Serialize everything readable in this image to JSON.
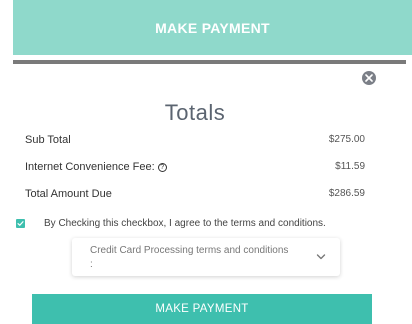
{
  "top_banner": {
    "label": "MAKE PAYMENT"
  },
  "modal": {
    "title": "Totals",
    "rows": [
      {
        "label": "Sub Total",
        "value": "$275.00"
      },
      {
        "label": "Internet Convenience Fee:",
        "value": "$11.59",
        "has_help_icon": true
      },
      {
        "label": "Total Amount Due",
        "value": "$286.59"
      }
    ],
    "agreement": {
      "checked": true,
      "text": "By Checking this checkbox, I agree to the terms and conditions."
    },
    "terms_dropdown": {
      "label": "Credit Card Processing terms and conditions :"
    },
    "pay_button": {
      "label": "MAKE PAYMENT"
    }
  },
  "colors": {
    "banner": "#8fd9cb",
    "accent": "#3ebfae",
    "title": "#5b6470"
  },
  "icons": {
    "close": "close-icon",
    "help": "question-circle-icon",
    "check": "check-icon",
    "chevron": "chevron-down-icon"
  }
}
